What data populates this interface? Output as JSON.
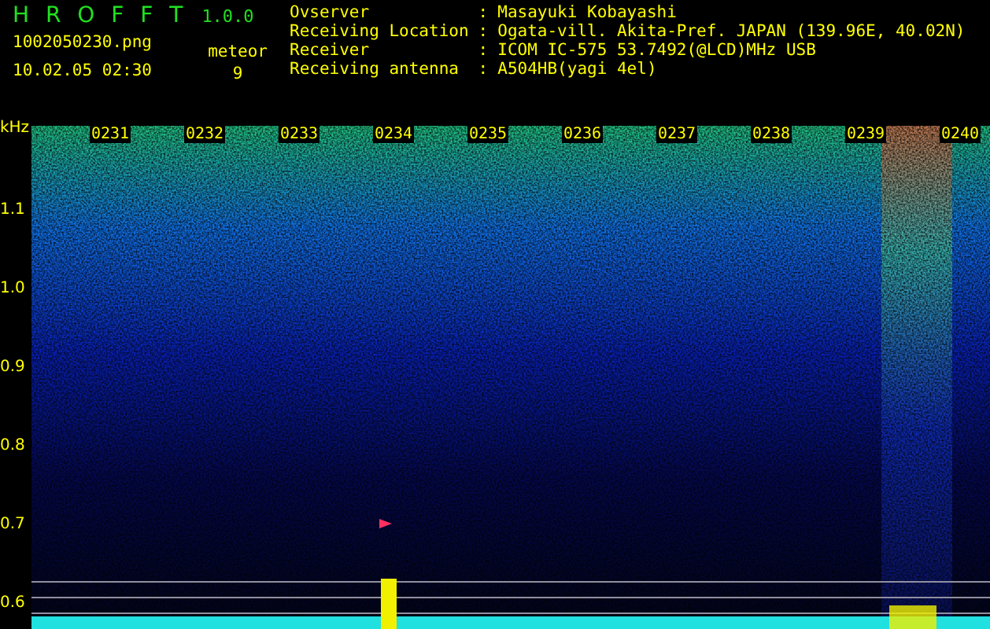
{
  "app": {
    "title": "H R O F F T",
    "version": "1.0.0",
    "file_name": "1002050230.png",
    "date_time": "10.02.05 02:30",
    "meteor_label": "meteor",
    "meteor_count": "9"
  },
  "station_info": [
    {
      "label": "Ovserver",
      "separator": ":",
      "value": "Masayuki Kobayashi"
    },
    {
      "label": "Receiving Location",
      "separator": ":",
      "value": "Ogata-vill. Akita-Pref. JAPAN (139.96E, 40.02N)"
    },
    {
      "label": "Receiver",
      "separator": ":",
      "value": "ICOM IC-575 53.7492(@LCD)MHz USB"
    },
    {
      "label": "Receiving antenna",
      "separator": ":",
      "value": "A504HB(yagi 4el)"
    }
  ],
  "spectrogram": {
    "y_unit": "kHz",
    "y_ticks": [
      "1.1",
      "1.0",
      "0.9",
      "0.8",
      "0.7",
      "0.6"
    ],
    "time_labels": [
      "0231",
      "0232",
      "0233",
      "0234",
      "0235",
      "0236",
      "0237",
      "0238",
      "0239",
      "0240"
    ]
  }
}
